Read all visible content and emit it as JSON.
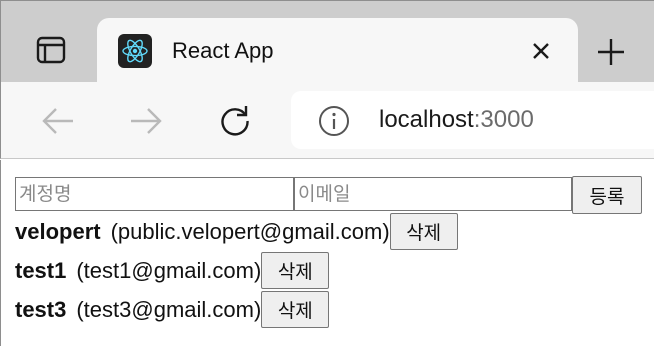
{
  "browser": {
    "tab": {
      "title": "React App",
      "favicon": "react-logo-icon"
    },
    "address_bar": {
      "host": "localhost",
      "port": ":3000"
    },
    "icons": {
      "tab_actions": "tab-actions-icon",
      "close": "close-icon",
      "new_tab": "plus-icon",
      "back": "back-arrow-icon",
      "forward": "forward-arrow-icon",
      "reload": "reload-icon",
      "site_info": "info-icon"
    },
    "colors": {
      "tab_strip": "#cdcdcd",
      "toolbar": "#f7f7f7",
      "react_blue": "#61dafb"
    }
  },
  "form": {
    "username_placeholder": "계정명",
    "email_placeholder": "이메일",
    "username_value": "",
    "email_value": "",
    "submit_label": "등록"
  },
  "users": [
    {
      "username": "velopert",
      "email": "(public.velopert@gmail.com)",
      "delete_label": "삭제"
    },
    {
      "username": "test1",
      "email": "(test1@gmail.com)",
      "delete_label": "삭제"
    },
    {
      "username": "test3",
      "email": "(test3@gmail.com)",
      "delete_label": "삭제"
    }
  ]
}
